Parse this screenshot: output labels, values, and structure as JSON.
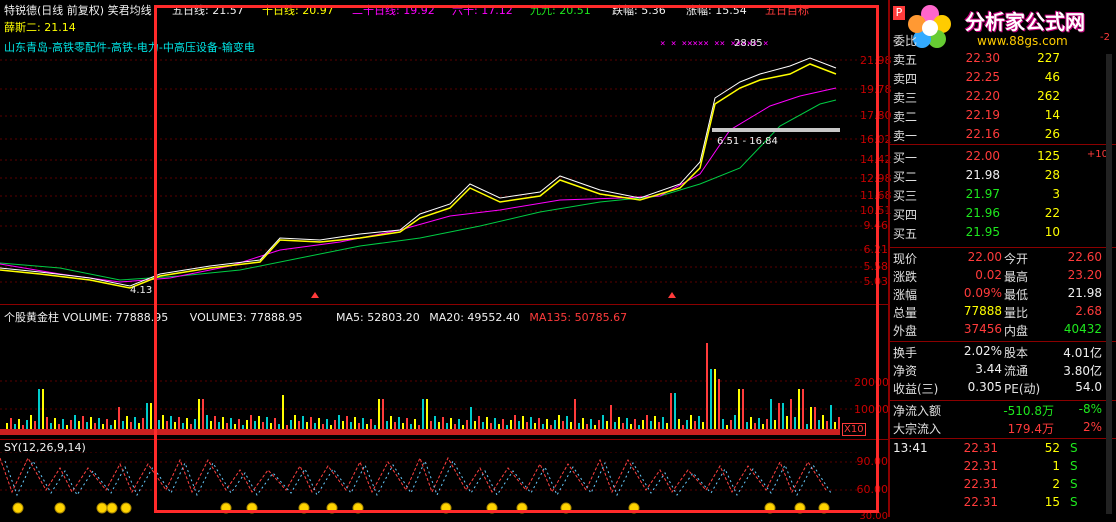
{
  "colors": {
    "up": "#ff3b3b",
    "down": "#1ee81e",
    "grid": "#5a0000",
    "highlight_box": "#ff2a2a",
    "ma_white": "#ffffff",
    "ma_yellow": "#ffff00",
    "ma_magenta": "#ff00ff",
    "ma_green": "#00ff66"
  },
  "header": {
    "title": "特锐德(日线 前复权) 笑君均线",
    "ma5": "五日线: 21.57",
    "ma10": "十日线: 20.97",
    "ma20": "二十日线: 19.92",
    "ma60": "六十: 17.12",
    "ma120": "九九: 20.51",
    "limit_down": "跌幅: 5.36",
    "limit_up": "涨幅: 15.54",
    "extra": "五日目标"
  },
  "overlay": {
    "indicator": "薛斯二: 21.14",
    "concepts": "山东青岛-高铁零配件-高铁-电力-中高压设备-输变电",
    "high_label": "28.85",
    "range_label": "6.51 - 16.84",
    "low_label": "4.13"
  },
  "price_axis": [
    "21.98",
    "19.78",
    "17.80",
    "16.02",
    "14.42",
    "12.98",
    "11.68",
    "10.51",
    "9.46",
    "6.21",
    "5.58",
    "5.03"
  ],
  "volume_panel": {
    "title": "个股黄金柱",
    "volume": "VOLUME: 77888.95",
    "volume3": "VOLUME3: 77888.95",
    "ma5": "MA5: 52803.20",
    "ma20": "MA20: 49552.40",
    "ma135": "MA135: 50785.67",
    "axis": [
      "20000",
      "10000"
    ],
    "scale": "X10"
  },
  "sy_panel": {
    "title": "SY(12,26,9,14)",
    "axis": [
      "90.00",
      "60.00",
      "30.00"
    ]
  },
  "logo": {
    "text": "分析家公式网",
    "url": "www.88gs.com"
  },
  "quote": {
    "weibi_label": "委比",
    "weibi_suffix": "-2",
    "asks": [
      {
        "label": "卖五",
        "price": "22.30",
        "vol": "227",
        "chg": ""
      },
      {
        "label": "卖四",
        "price": "22.25",
        "vol": "46",
        "chg": ""
      },
      {
        "label": "卖三",
        "price": "22.20",
        "vol": "262",
        "chg": ""
      },
      {
        "label": "卖二",
        "price": "22.19",
        "vol": "14",
        "chg": ""
      },
      {
        "label": "卖一",
        "price": "22.16",
        "vol": "26",
        "chg": ""
      }
    ],
    "bids": [
      {
        "label": "买一",
        "price": "22.00",
        "vol": "125",
        "chg": "+10"
      },
      {
        "label": "买二",
        "price": "21.98",
        "vol": "28",
        "chg": ""
      },
      {
        "label": "买三",
        "price": "21.97",
        "vol": "3",
        "chg": ""
      },
      {
        "label": "买四",
        "price": "21.96",
        "vol": "22",
        "chg": ""
      },
      {
        "label": "买五",
        "price": "21.95",
        "vol": "10",
        "chg": ""
      }
    ],
    "stats": [
      {
        "l1": "现价",
        "v1": "22.00",
        "c1": "red",
        "l2": "今开",
        "v2": "22.60",
        "c2": "red"
      },
      {
        "l1": "涨跌",
        "v1": "0.02",
        "c1": "red",
        "l2": "最高",
        "v2": "23.20",
        "c2": "red"
      },
      {
        "l1": "涨幅",
        "v1": "0.09%",
        "c1": "red",
        "l2": "最低",
        "v2": "21.98",
        "c2": "white"
      },
      {
        "l1": "总量",
        "v1": "77888",
        "c1": "yellow",
        "l2": "量比",
        "v2": "2.68",
        "c2": "red"
      },
      {
        "l1": "外盘",
        "v1": "37456",
        "c1": "red",
        "l2": "内盘",
        "v2": "40432",
        "c2": "green"
      }
    ],
    "stats2": [
      {
        "l1": "换手",
        "v1": "2.02%",
        "l2": "股本",
        "v2": "4.01亿"
      },
      {
        "l1": "净资",
        "v1": "3.44",
        "l2": "流通",
        "v2": "3.80亿"
      },
      {
        "l1": "收益(三)",
        "v1": "0.305",
        "l2": "PE(动)",
        "v2": "54.0"
      }
    ],
    "flow": [
      {
        "label": "净流入额",
        "value": "-510.8万",
        "pct": "-8%",
        "color": "green"
      },
      {
        "label": "大宗流入",
        "value": "179.4万",
        "pct": "2%",
        "color": "red"
      }
    ],
    "ticks": [
      {
        "time": "13:41",
        "price": "22.31",
        "vol": "52",
        "side": "S"
      },
      {
        "time": "",
        "price": "22.31",
        "vol": "1",
        "side": "S"
      },
      {
        "time": "",
        "price": "22.31",
        "vol": "2",
        "side": "S"
      },
      {
        "time": "",
        "price": "22.31",
        "vol": "15",
        "side": "S"
      }
    ]
  }
}
